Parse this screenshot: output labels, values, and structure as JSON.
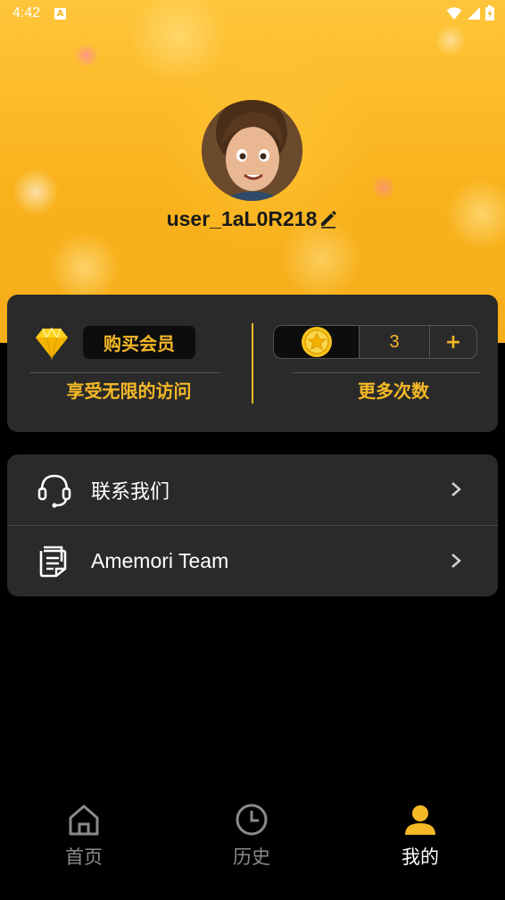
{
  "status_bar": {
    "time": "4:42",
    "notification_icon": "A"
  },
  "profile": {
    "username": "user_1aL0R218",
    "edit_icon": "pencil-icon",
    "avatar": "avatar-boy"
  },
  "vip": {
    "buy_label": "购买会员",
    "left_subtitle": "享受无限的访问",
    "count": "3",
    "plus_label": "+",
    "right_subtitle": "更多次数"
  },
  "menu": [
    {
      "label": "联系我们",
      "icon": "headset-icon"
    },
    {
      "label": "Amemori Team",
      "icon": "document-icon"
    }
  ],
  "bottom_nav": [
    {
      "label": "首页",
      "icon": "home-icon",
      "active": false
    },
    {
      "label": "历史",
      "icon": "clock-icon",
      "active": false
    },
    {
      "label": "我的",
      "icon": "user-icon",
      "active": true
    }
  ],
  "colors": {
    "accent": "#f5b826",
    "card": "#2a2a2a",
    "background": "#000000",
    "inactive_nav": "#8a8a8a"
  }
}
